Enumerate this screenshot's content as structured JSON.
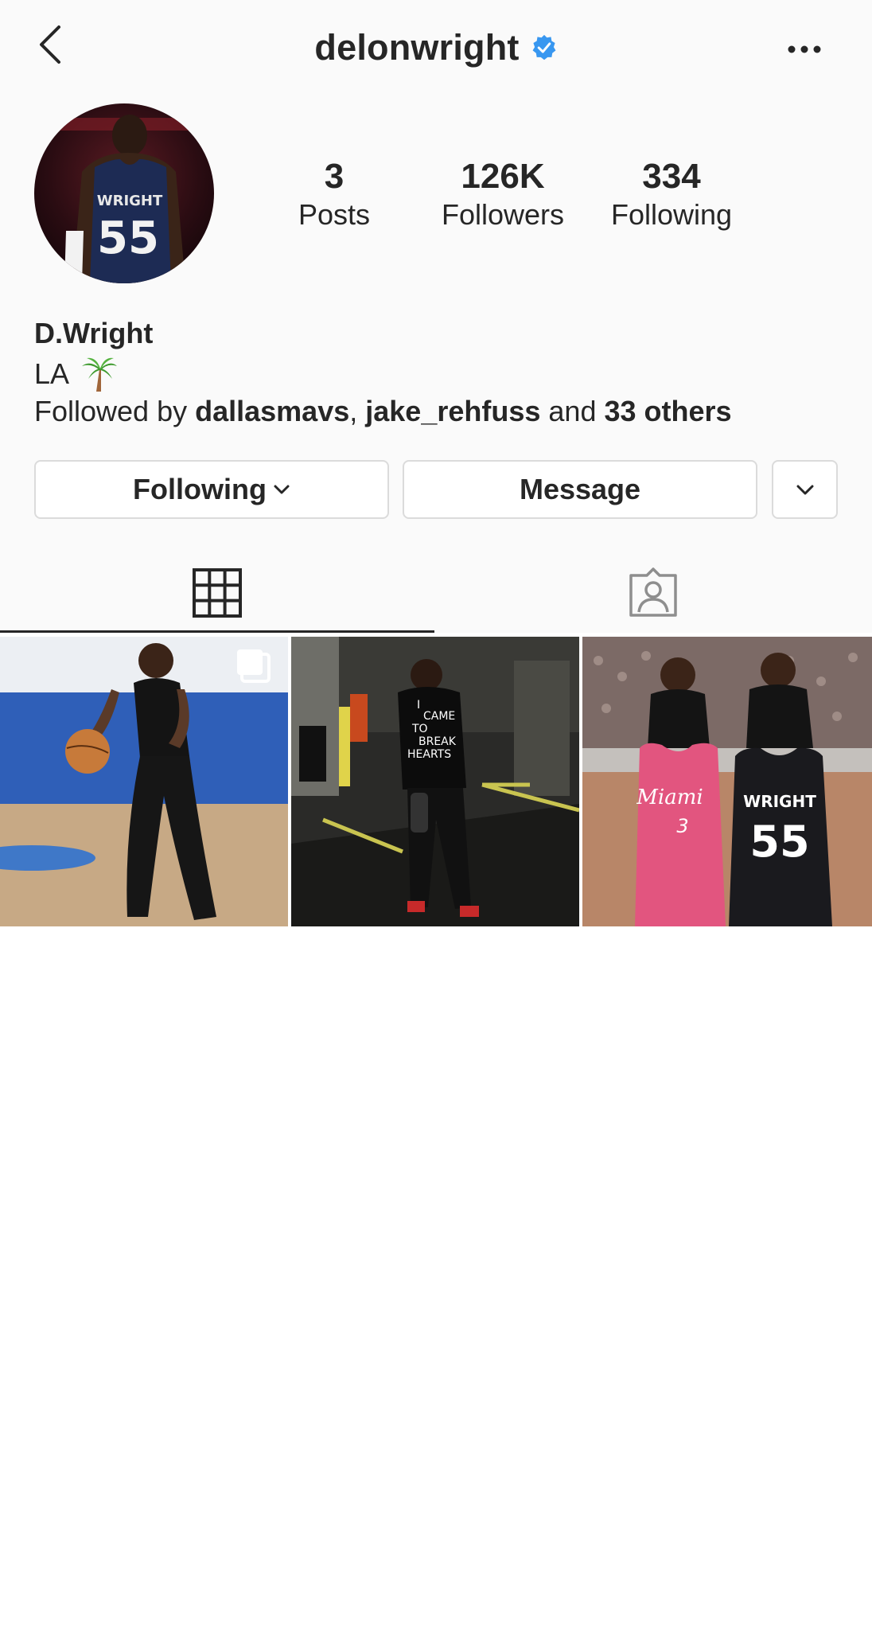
{
  "header": {
    "username": "delonwright",
    "verified_icon": "verified-badge-icon",
    "verified_color": "#3897f0"
  },
  "profile": {
    "stats": [
      {
        "value": "3",
        "label": "Posts"
      },
      {
        "value": "126K",
        "label": "Followers"
      },
      {
        "value": "334",
        "label": "Following"
      }
    ],
    "name": "D.Wright",
    "location": "LA",
    "location_emoji": "palm-tree",
    "followed_by": {
      "prefix": "Followed by ",
      "user1": "dallasmavs",
      "sep": ", ",
      "user2": "jake_rehfuss",
      "and": " and ",
      "others": "33 others"
    }
  },
  "actions": {
    "following_label": "Following",
    "message_label": "Message"
  },
  "tabs": [
    {
      "name": "grid",
      "icon": "grid-icon",
      "active": true
    },
    {
      "name": "tagged",
      "icon": "tagged-person-icon",
      "active": false
    }
  ],
  "posts": [
    {
      "id": "post-1",
      "kind": "multiple",
      "jersey_name": "",
      "jersey_number": ""
    },
    {
      "id": "post-2",
      "shirt_lines": [
        "I",
        "CAME",
        "TO",
        "BREAK",
        "HEARTS"
      ]
    },
    {
      "id": "post-3",
      "jersey_left": "Miami",
      "jersey_left_number": "3",
      "jersey_right": "WRIGHT",
      "jersey_right_number": "55"
    }
  ],
  "avatar": {
    "jersey_name": "WRIGHT",
    "jersey_number": "55"
  },
  "colors": {
    "accent_pink": "#e2557f",
    "navy": "#1d2b54"
  }
}
